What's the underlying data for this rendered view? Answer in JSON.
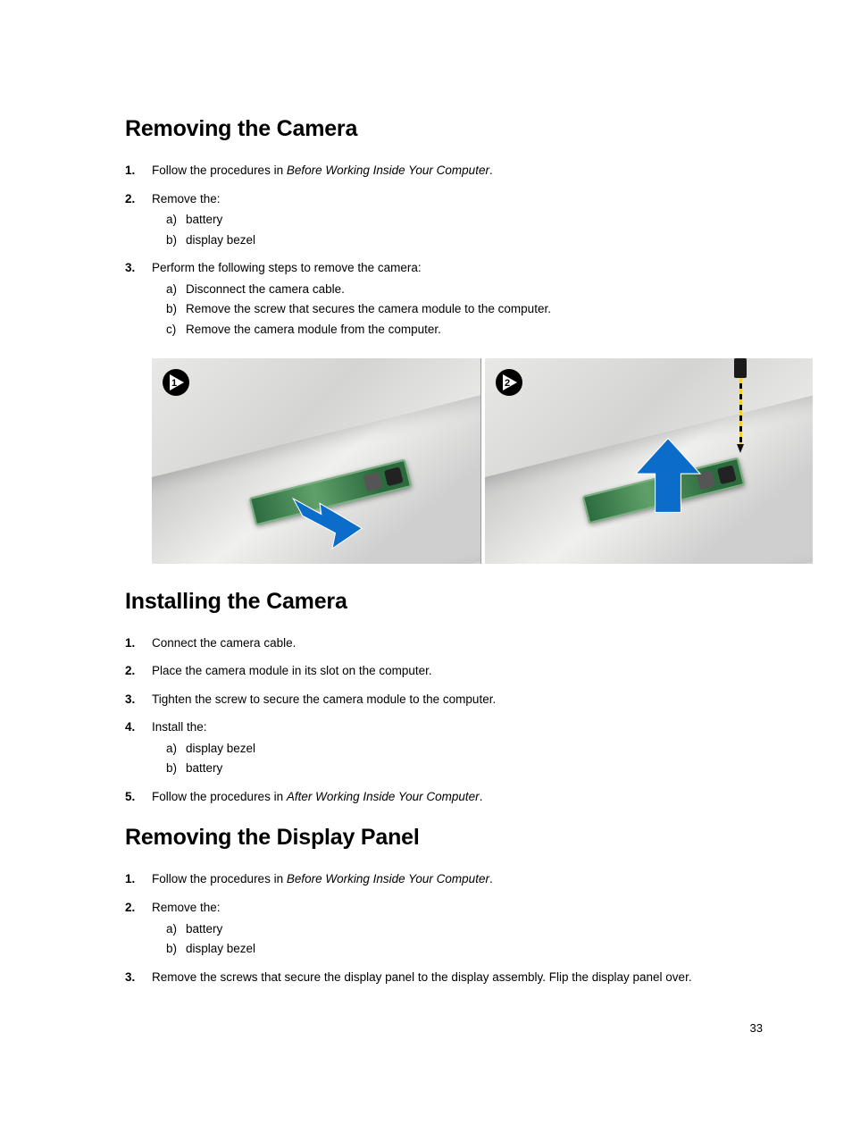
{
  "page_number": "33",
  "sections": [
    {
      "heading": "Removing the Camera",
      "steps": [
        {
          "pre": "Follow the procedures in ",
          "ref": "Before Working Inside Your Computer",
          "post": "."
        },
        {
          "text": "Remove the:",
          "sub": [
            "battery",
            "display bezel"
          ]
        },
        {
          "text": "Perform the following steps to remove the camera:",
          "sub": [
            "Disconnect the camera cable.",
            "Remove the screw that secures the camera module to the computer.",
            "Remove the camera module from the computer."
          ]
        }
      ],
      "figure": {
        "panes": [
          {
            "badge": "1",
            "arrow_dir": "diag-down-right"
          },
          {
            "badge": "2",
            "arrow_dir": "up",
            "screwdriver": true
          }
        ]
      }
    },
    {
      "heading": "Installing the Camera",
      "steps": [
        {
          "text": "Connect the camera cable."
        },
        {
          "text": "Place the camera module in its slot on the computer."
        },
        {
          "text": "Tighten the screw to secure the camera module to the computer."
        },
        {
          "text": "Install the:",
          "sub": [
            "display bezel",
            "battery"
          ]
        },
        {
          "pre": "Follow the procedures in ",
          "ref": "After Working Inside Your Computer",
          "post": "."
        }
      ]
    },
    {
      "heading": "Removing the Display Panel",
      "steps": [
        {
          "pre": "Follow the procedures in ",
          "ref": "Before Working Inside Your Computer",
          "post": "."
        },
        {
          "text": "Remove the:",
          "sub": [
            "battery",
            "display bezel"
          ]
        },
        {
          "text": "Remove the screws that secure the display panel to the display assembly. Flip the display panel over."
        }
      ]
    }
  ]
}
